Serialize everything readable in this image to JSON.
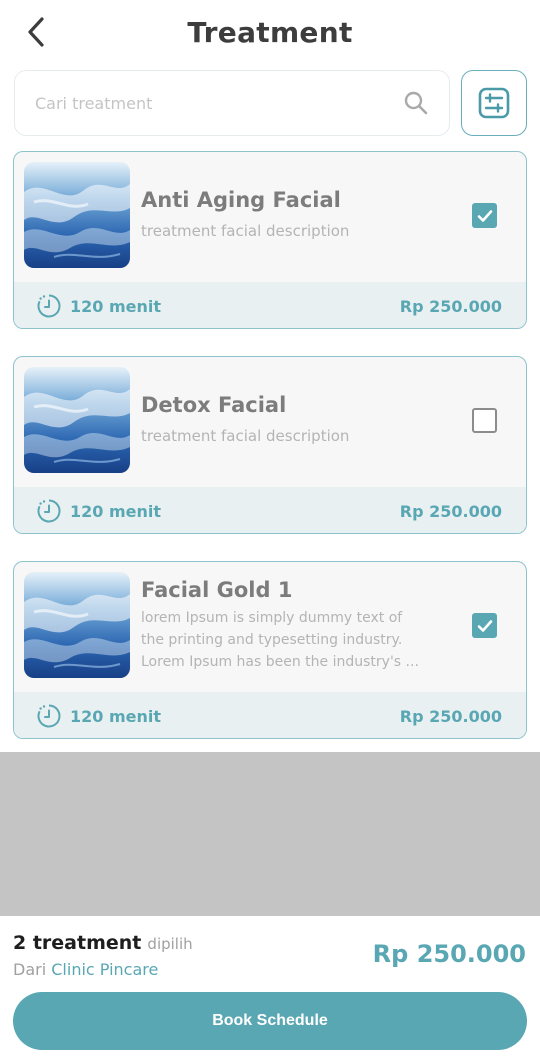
{
  "header": {
    "title": "Treatment",
    "back_icon": "chevron-left-icon"
  },
  "search": {
    "placeholder": "Cari treatment",
    "value": "",
    "icon": "search-icon"
  },
  "filter": {
    "icon": "sliders-icon"
  },
  "colors": {
    "accent": "#5aa7b4",
    "card_border": "#8cc3cd",
    "card_bg": "#f7f7f7",
    "card_footer_bg": "#e9f0f1",
    "overlay": "#c4c4c4"
  },
  "treatments": [
    {
      "name": "Anti Aging Facial",
      "description": "treatment facial description",
      "checked": true,
      "duration": "120 menit",
      "price": "Rp 250.000"
    },
    {
      "name": "Detox Facial",
      "description": "treatment facial description",
      "checked": false,
      "duration": "120 menit",
      "price": "Rp 250.000"
    },
    {
      "name": "Facial Gold 1",
      "description": "lorem Ipsum is simply dummy text of the printing and typesetting industry. Lorem Ipsum has been the industry's ...",
      "desc_lines": [
        "lorem Ipsum is simply dummy text of",
        "the printing and typesetting industry.",
        "Lorem Ipsum has been the industry's ..."
      ],
      "checked": true,
      "duration": "120 menit",
      "price": "Rp 250.000"
    }
  ],
  "footer": {
    "count": "2 treatment",
    "count_suffix": "dipilih",
    "clinic_prefix": "Dari",
    "clinic_name": "Clinic Pincare",
    "total": "Rp 250.000",
    "book_label": "Book Schedule"
  }
}
